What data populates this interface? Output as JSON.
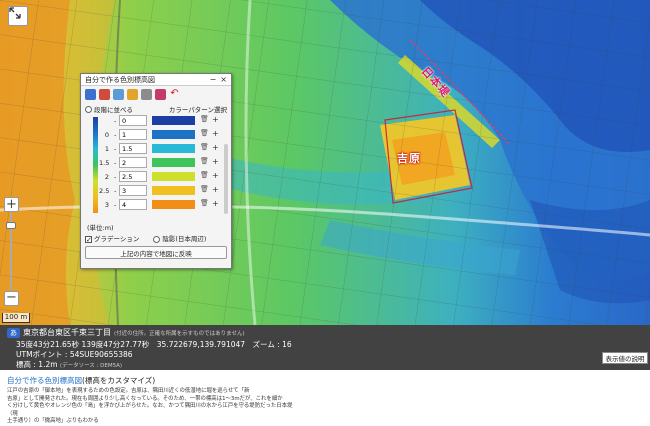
{
  "map": {
    "place_labels": [
      "日本堤",
      "吉原"
    ],
    "scale_label": "100 m",
    "zoom_in_label": "+",
    "zoom_out_label": "−"
  },
  "panel": {
    "title": "自分で作る色別標高図",
    "minimize": "−",
    "close": "×",
    "option_left": "段階に並べる",
    "option_right": "カラーパターン選択",
    "unit": "(単位:m)",
    "gradation": "グラデーション",
    "hillshade": "陰影(日本周辺)",
    "apply_label": "上記の内容で地図に反映",
    "rows": [
      {
        "lo": "",
        "hi": "0",
        "color": "#1b3fa3"
      },
      {
        "lo": "0",
        "hi": "1",
        "color": "#1e72c6"
      },
      {
        "lo": "1",
        "hi": "1.5",
        "color": "#29b9d7"
      },
      {
        "lo": "1.5",
        "hi": "2",
        "color": "#3fc35b"
      },
      {
        "lo": "2",
        "hi": "2.5",
        "color": "#cfe02c"
      },
      {
        "lo": "2.5",
        "hi": "3",
        "color": "#f0c020"
      },
      {
        "lo": "3",
        "hi": "4",
        "color": "#f08e18"
      }
    ],
    "delete_icon": "🗑",
    "add_icon": "+"
  },
  "info": {
    "badge": "あ",
    "address": "東京都台東区千束三丁目",
    "note": "(付近の住所。正確な所属を示すものではありません)",
    "coords": "35度43分21.65秒 139度47分27.77秒　35.722679,139.791047　ズーム : 16",
    "utm": "UTMポイント : 54SUE90655386",
    "elev_label": "標高 : 1.2m",
    "elev_src": "(データソース : DEM5A)",
    "explain_button": "表示値の説明"
  },
  "caption": {
    "link": "自分で作る色別標高図",
    "suffix": "(標高をカスタマイズ)",
    "lines": [
      "江戸の吉原の「御本地」を表現するための色設定。吉原は、隅田川近くの低湿地に堀を巡らせて「新",
      "吉原」として開発された。現在も周囲より少し高くなっている。そのため、一帯の標高は1〜3mだが、これを細か",
      "く分けして黄色やオレンジ色の「島」を浮かび上がらせた。なお、かつて隅田川の水から江戸を守る堤防だった日本堤（現",
      "土手通り）の「微高地」ぶりもわかる"
    ]
  },
  "colors": {
    "deep_blue": "#1b3fa3",
    "blue": "#1e72c6",
    "cyan": "#29b9d7",
    "green": "#3fc35b",
    "yellow_green": "#cfe02c",
    "yellow": "#f0c020",
    "orange": "#f08e18"
  }
}
